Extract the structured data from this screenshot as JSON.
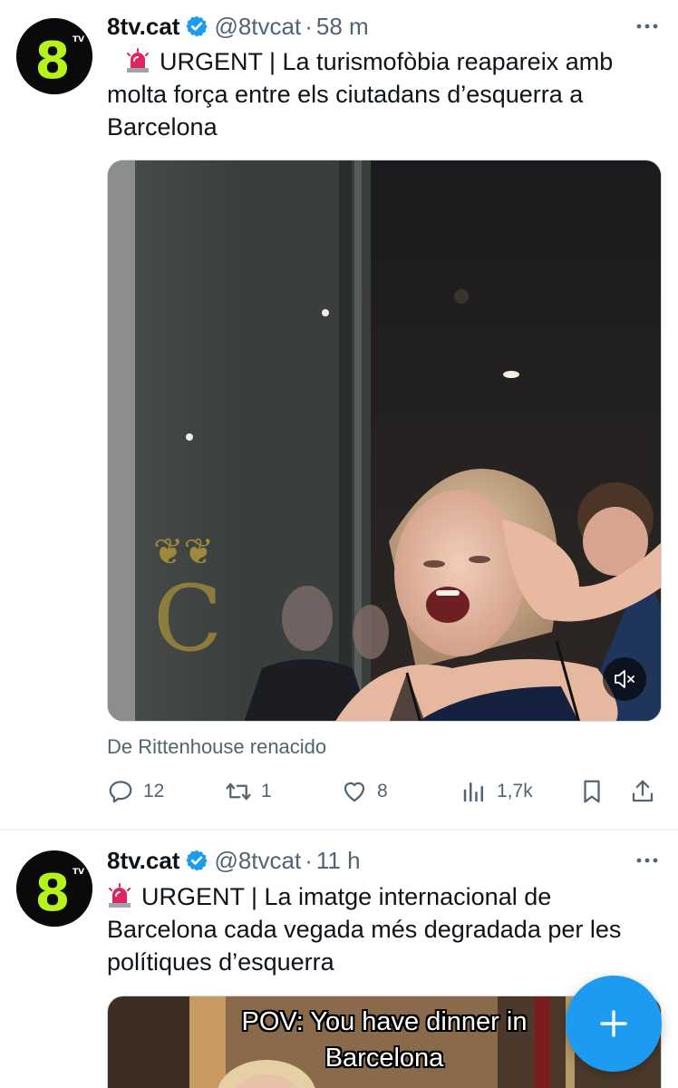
{
  "tweets": [
    {
      "display_name": "8tv.cat",
      "handle": "@8tvcat",
      "separator": "·",
      "time": "58 m",
      "siren": "🚨",
      "text": "URGENT | La turismofòbia reapareix amb molta força entre els ciutadans d’esquerra a Barcelona",
      "attribution": "De Rittenhouse renacido",
      "stats": {
        "replies": "12",
        "retweets": "1",
        "likes": "8",
        "views": "1,7k"
      }
    },
    {
      "display_name": "8tv.cat",
      "handle": "@8tvcat",
      "separator": "·",
      "time": "11 h",
      "siren": "🚨",
      "text": "URGENT | La imatge internacional de Barcelona cada vegada més degradada per les polítiques d’esquerra",
      "media_caption_line1": "POV: You have dinner in",
      "media_caption_line2": "Barcelona"
    }
  ],
  "colors": {
    "accent": "#1d9bf0",
    "secondary_text": "#536471",
    "logo_green": "#b6f21c",
    "siren_red": "#e0245e"
  },
  "icons": {
    "avatar": "8tv-logo",
    "verified": "verified-badge-icon",
    "more": "more-dots-icon",
    "reply": "reply-icon",
    "retweet": "retweet-icon",
    "like": "heart-icon",
    "views": "views-bar-chart-icon",
    "bookmark": "bookmark-icon",
    "share": "share-icon",
    "mute": "muted-speaker-icon",
    "compose": "plus-icon"
  }
}
